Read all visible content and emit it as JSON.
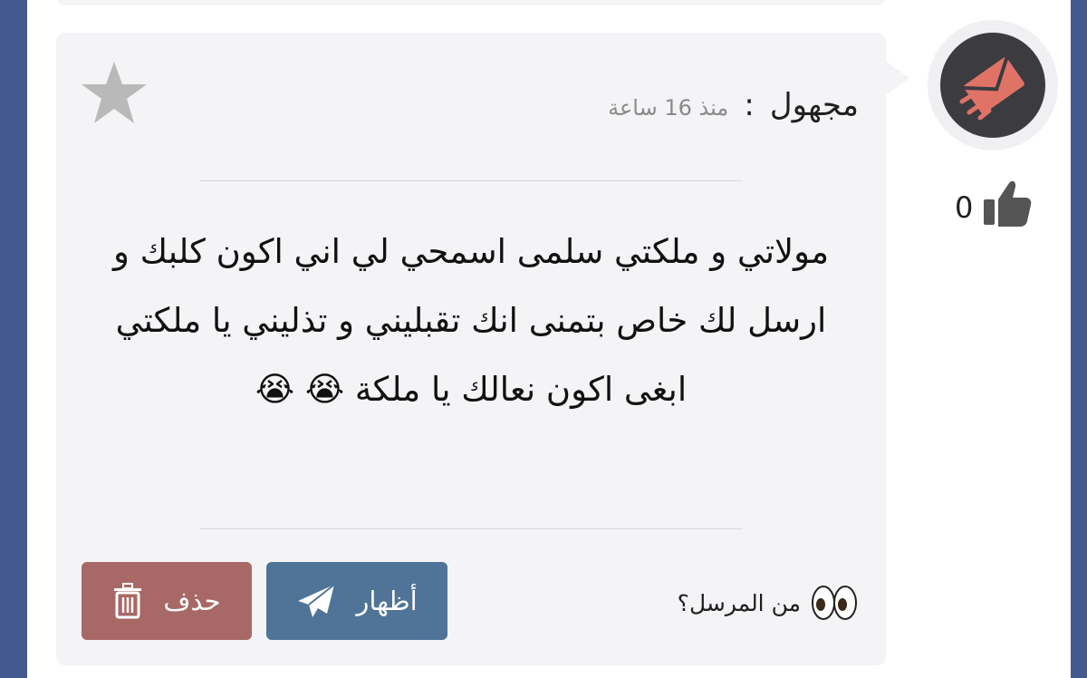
{
  "message": {
    "sender_name": "مجهول",
    "separator": ":",
    "time_ago": "منذ 16 ساعة",
    "body": "مولاتي و ملكتي سلمى اسمحي لي اني اكون كلبك و ارسل لك خاص بتمنى انك تقبليني و تذليني يا ملكتي ابغى اكون نعالك يا ملكة 😭 😭",
    "like_count": "0"
  },
  "actions": {
    "show_label": "أظهار",
    "delete_label": "حذف",
    "sender_question": "من المرسل؟"
  },
  "icons": {
    "avatar": "envelope-icon",
    "like": "thumbs-up-icon",
    "favorite": "star-icon",
    "show": "paper-plane-icon",
    "delete": "trash-icon",
    "eyes": "eyes-icon"
  },
  "colors": {
    "page_background": "#44598f",
    "card_background": "#f4f4f7",
    "show_button": "#4f7497",
    "delete_button": "#a86866",
    "avatar_bg": "#3b3b40",
    "envelope": "#e07366",
    "star": "#b9b9b9",
    "thumb": "#555555"
  }
}
